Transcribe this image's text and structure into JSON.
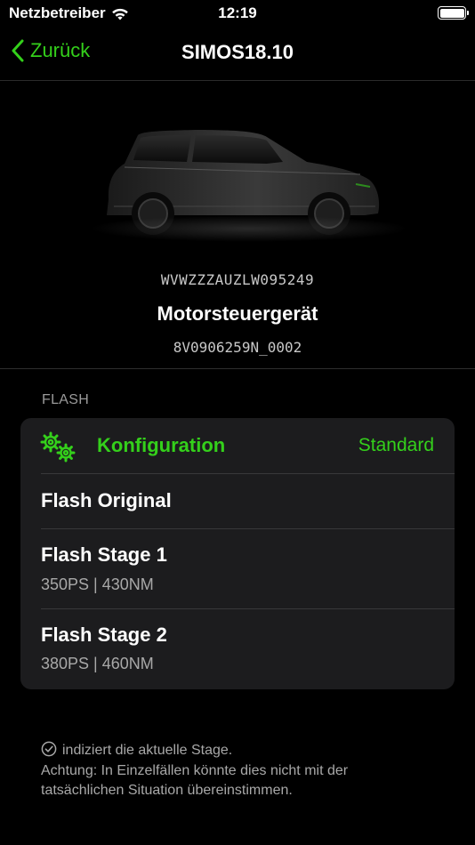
{
  "status_bar": {
    "carrier": "Netzbetreiber",
    "time": "12:19",
    "icons": [
      "wifi-icon",
      "battery-icon"
    ]
  },
  "nav": {
    "back_label": "Zurück",
    "title": "SIMOS18.10"
  },
  "vehicle": {
    "vin": "WVWZZZAUZLW095249",
    "ecu_name": "Motorsteuergerät",
    "ecu_part": "8V0906259N_0002"
  },
  "flash_section": {
    "header": "FLASH",
    "config": {
      "icon": "gears-icon",
      "label": "Konfiguration",
      "value": "Standard"
    },
    "items": [
      {
        "label": "Flash Original",
        "sub": ""
      },
      {
        "label": "Flash Stage 1",
        "sub": "350PS | 430NM"
      },
      {
        "label": "Flash Stage 2",
        "sub": "380PS | 460NM"
      }
    ]
  },
  "footer": {
    "line1": "indiziert die aktuelle Stage.",
    "line2": "Achtung: In Einzelfällen könnte dies nicht mit der tatsächlichen Situation übereinstimmen."
  },
  "colors": {
    "accent": "#34d01b",
    "background": "#000000",
    "card": "#1c1c1e"
  }
}
